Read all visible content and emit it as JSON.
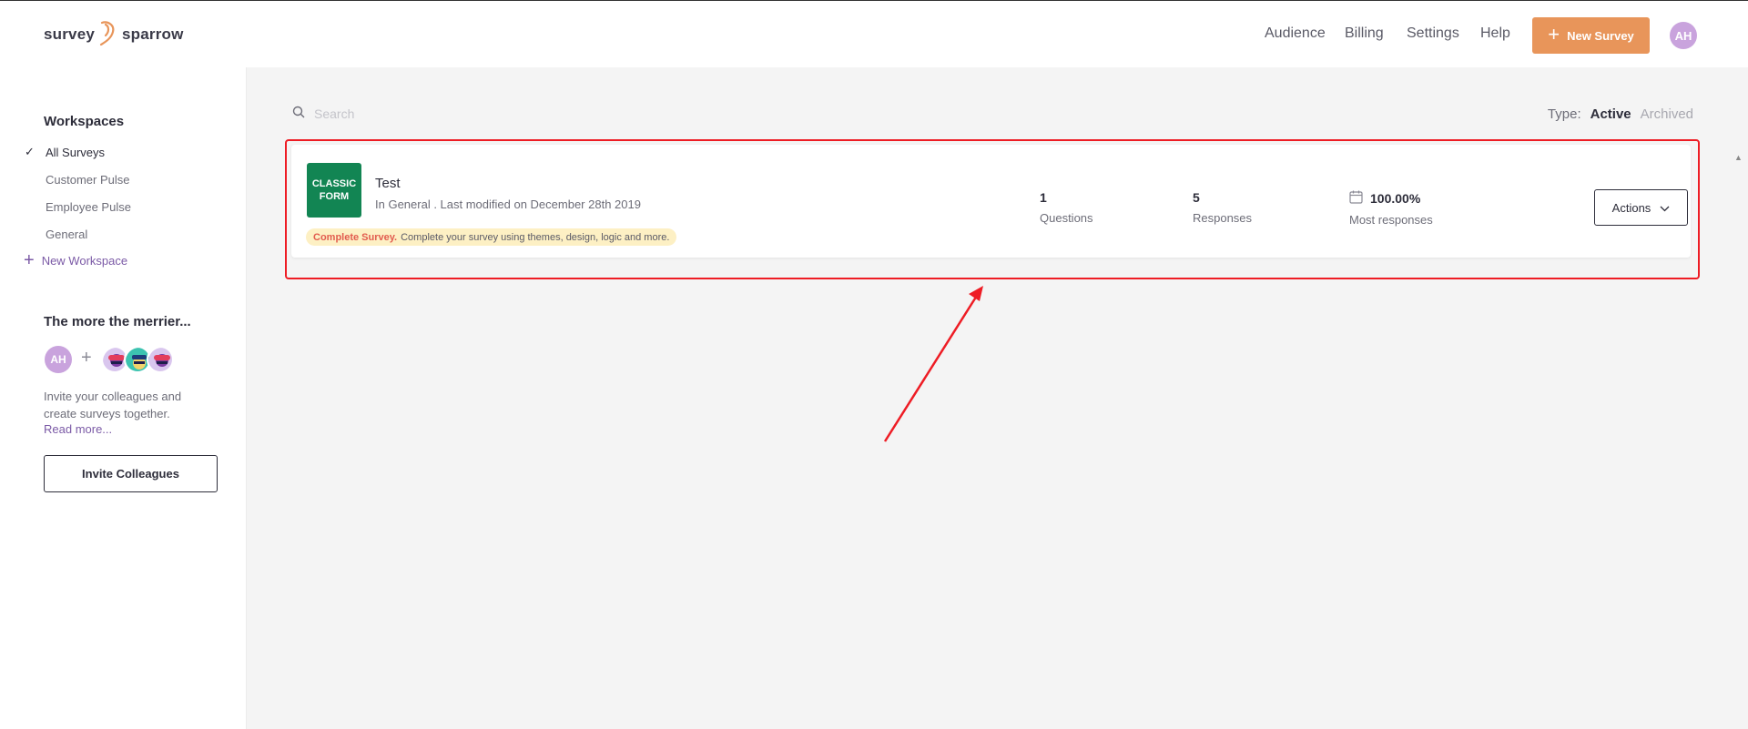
{
  "app": {
    "logo_left": "survey",
    "logo_right": "sparrow"
  },
  "header": {
    "nav": [
      "Audience",
      "Billing",
      "Settings",
      "Help"
    ],
    "new_survey_label": "New Survey",
    "user_initials": "AH"
  },
  "sidebar": {
    "workspaces_title": "Workspaces",
    "items": [
      {
        "label": "All Surveys",
        "active": true
      },
      {
        "label": "Customer Pulse",
        "active": false
      },
      {
        "label": "Employee Pulse",
        "active": false
      },
      {
        "label": "General",
        "active": false
      }
    ],
    "new_workspace_label": "New Workspace",
    "merrier_title": "The more the merrier...",
    "me_initials": "AH",
    "invite_text": "Invite your colleagues and create surveys together.",
    "read_more": "Read more...",
    "invite_button": "Invite Colleagues"
  },
  "main": {
    "search_placeholder": "Search",
    "type_label": "Type:",
    "type_active": "Active",
    "type_archived": "Archived"
  },
  "survey": {
    "badge_line1": "CLASSIC",
    "badge_line2": "FORM",
    "title": "Test",
    "meta": "In General . Last modified on December 28th 2019",
    "hint_strong": "Complete Survey.",
    "hint_text": "Complete your survey using themes, design, logic and more.",
    "questions_value": "1",
    "questions_label": "Questions",
    "responses_value": "5",
    "responses_label": "Responses",
    "most_value": "100.00%",
    "most_label": "Most responses",
    "actions_label": "Actions"
  },
  "colors": {
    "accent": "#e8955a",
    "badge": "#128553",
    "highlight": "#ee1c24",
    "link": "#7b5aa6"
  }
}
